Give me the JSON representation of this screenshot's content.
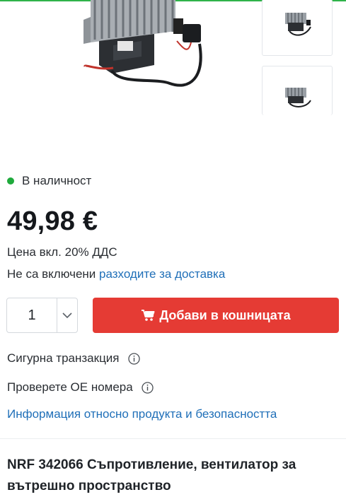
{
  "stock": {
    "label": "В наличност",
    "color": "#1faa3c"
  },
  "price": {
    "value": "49,98 €"
  },
  "vat_note": "Цена вкл. 20% ДДС",
  "shipping": {
    "prefix": "Не са включени",
    "link": "разходите за доставка"
  },
  "quantity": {
    "value": "1"
  },
  "add_to_cart": {
    "label": "Добави в кошницата",
    "color": "#e53b34"
  },
  "secure_transaction": {
    "label": "Сигурна транзакция"
  },
  "check_oe": {
    "label": "Проверете ОЕ номера"
  },
  "safety_info_link": "Информация относно продукта и безопасността",
  "product_title": "NRF 342066 Съпротивление, вентилатор за вътрешно пространство",
  "icons": [
    "cart-icon",
    "info-icon",
    "chevron-down-icon"
  ]
}
